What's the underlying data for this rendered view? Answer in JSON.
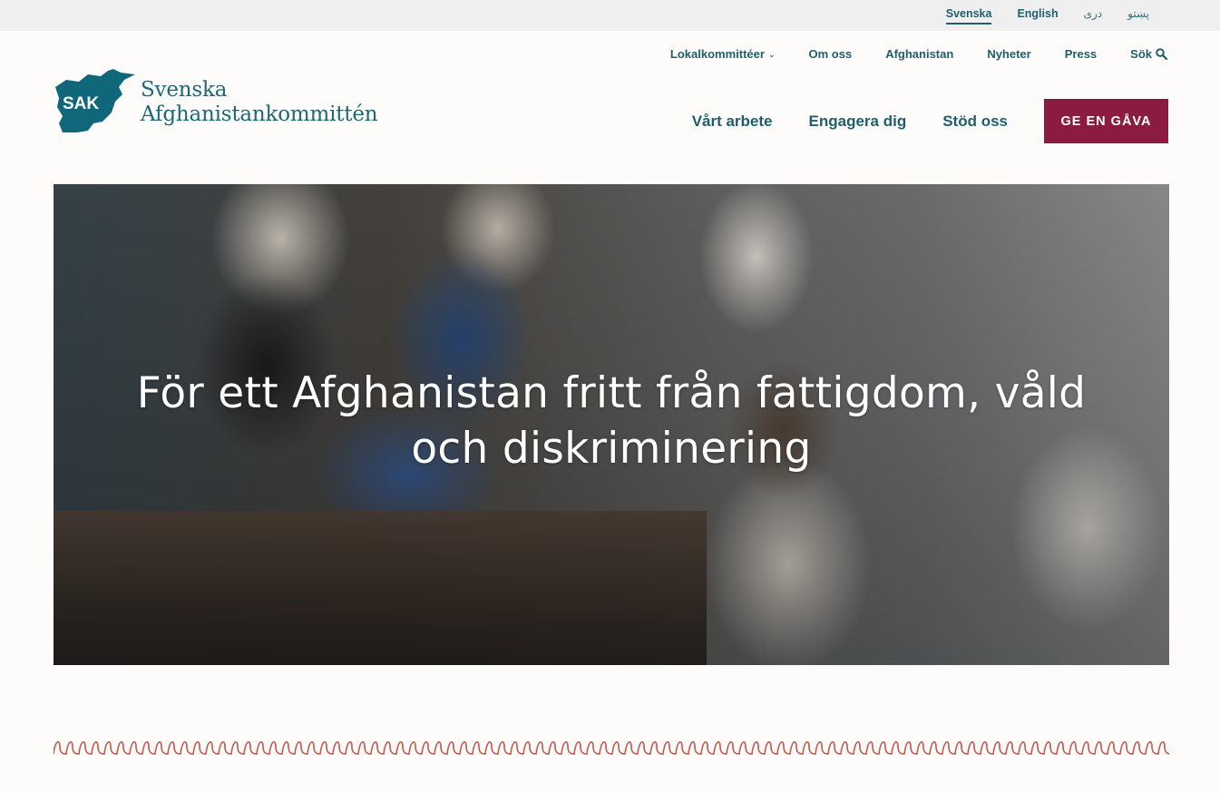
{
  "languages": [
    {
      "label": "Svenska",
      "active": true
    },
    {
      "label": "English",
      "active": false
    },
    {
      "label": "دری",
      "active": false
    },
    {
      "label": "پښتو",
      "active": false
    }
  ],
  "top_nav": {
    "local_committees": "Lokalkommittéer",
    "about": "Om oss",
    "afghanistan": "Afghanistan",
    "news": "Nyheter",
    "press": "Press",
    "search": "Sök"
  },
  "logo": {
    "badge": "SAK",
    "line1": "Svenska",
    "line2": "Afghanistankommittén"
  },
  "main_nav": {
    "our_work": "Vårt arbete",
    "engage": "Engagera dig",
    "support": "Stöd oss",
    "donate": "GE EN GÅVA"
  },
  "hero": {
    "headline_line1": "För ett Afghanistan fritt från fattigdom, våld",
    "headline_line2": "och diskriminering"
  },
  "colors": {
    "brand_teal": "#1f5f6d",
    "logo_teal": "#0f6779",
    "donate_bg": "#8c1c3f",
    "zigzag": "#c4584a",
    "lang_bar_bg": "#efefef"
  },
  "icons": [
    "search-icon",
    "chevron-down-icon",
    "afghanistan-map-logo-icon"
  ]
}
